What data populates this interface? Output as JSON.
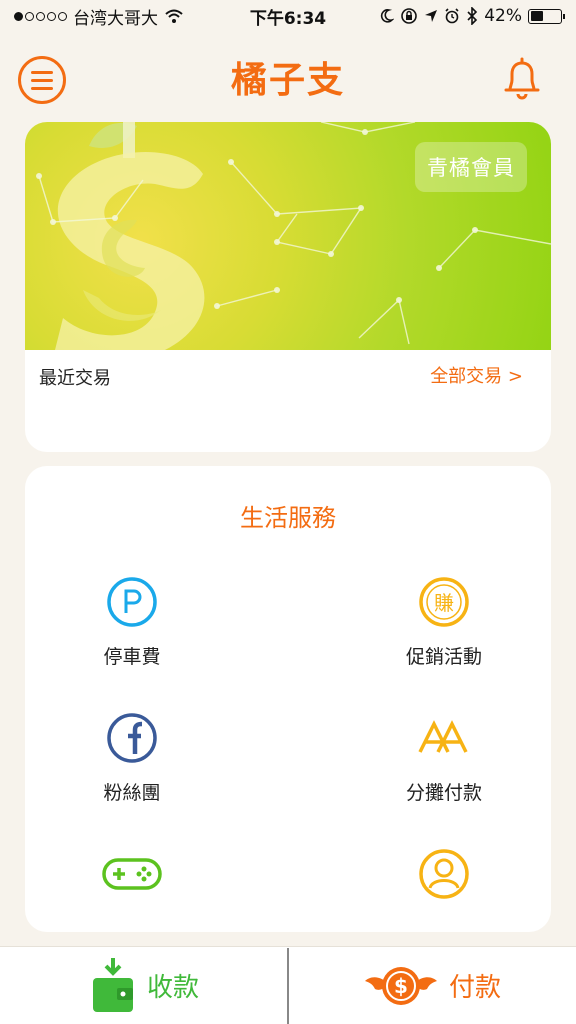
{
  "status_bar": {
    "carrier": "台湾大哥大",
    "time": "下午6:34",
    "battery": "42%",
    "battery_level": 0.42
  },
  "header": {
    "title": "橘子支"
  },
  "member_card": {
    "badge": "青橘會員",
    "recent_label": "最近交易",
    "all_link": "全部交易 >"
  },
  "services": {
    "title": "生活服務",
    "items": [
      {
        "label": "停車費",
        "icon": "parking-icon"
      },
      {
        "label": "促銷活動",
        "icon": "earn-icon"
      },
      {
        "label": "粉絲團",
        "icon": "facebook-icon"
      },
      {
        "label": "分攤付款",
        "icon": "split-pay-icon"
      },
      {
        "label": "",
        "icon": "gamepad-icon"
      },
      {
        "label": "",
        "icon": "user-icon"
      }
    ]
  },
  "bottom_bar": {
    "receive": "收款",
    "pay": "付款"
  },
  "colors": {
    "accent": "#f36c12",
    "green": "#40b93a",
    "background": "#f7f3ec"
  }
}
